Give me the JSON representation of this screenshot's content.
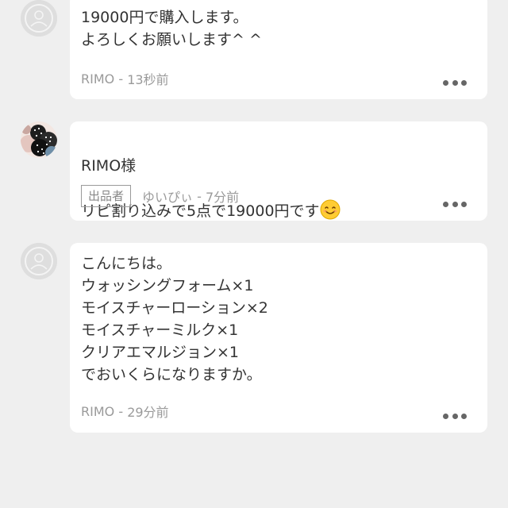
{
  "comments": [
    {
      "author": "RIMO",
      "time": "13秒前",
      "body": "19000円で購入します。\nよろしくお願いします^ ^",
      "seller_badge": null
    },
    {
      "author": "ゆいぴぃ",
      "time": "7分前",
      "body_lines": [
        "RIMO様",
        "リピ割り込みで5点で19000円です"
      ],
      "seller_badge": "出品者"
    },
    {
      "author": "RIMO",
      "time": "29分前",
      "body": "こんにちは。\nウォッシングフォーム×1\nモイスチャーローション×2\nモイスチャーミルク×1\nクリアエマルジョン×1\nでおいくらになりますか。",
      "seller_badge": null
    }
  ],
  "separator": " - ",
  "icons": {
    "default_avatar": "default-user-icon",
    "more": "more-horizontal-icon",
    "emoji": "smiling-face-emoji"
  },
  "colors": {
    "background": "#efefef",
    "bubble": "#ffffff",
    "meta_text": "#9a9a9a",
    "body_text": "#333333"
  }
}
